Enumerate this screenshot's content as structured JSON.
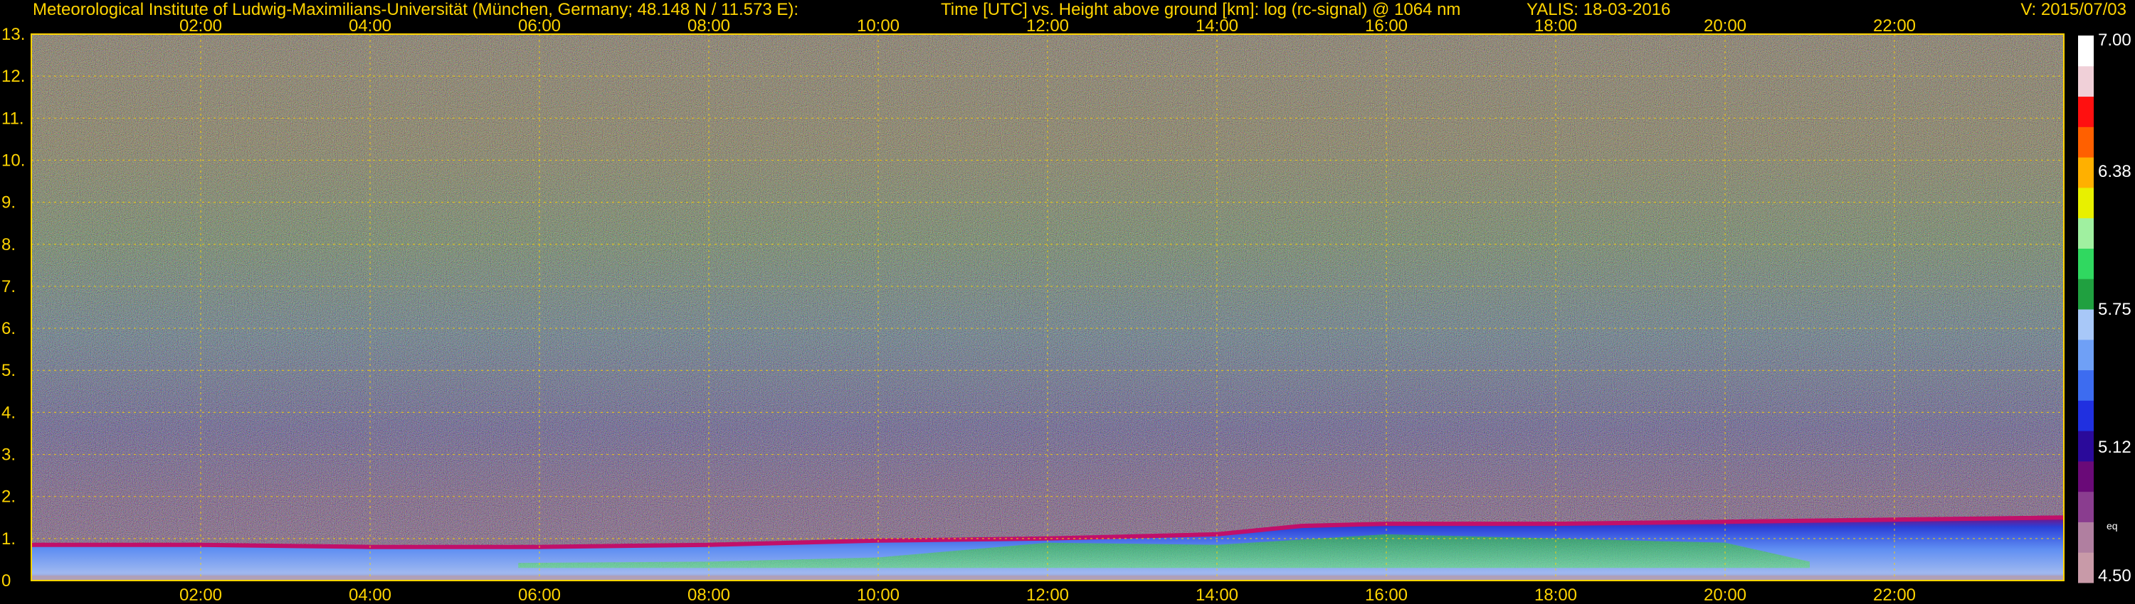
{
  "header": {
    "institute": "Meteorological Institute of Ludwig-Maximilians-Universität (München, Germany; 48.148 N / 11.573 E):",
    "title": "Time [UTC] vs. Height above ground [km]: log (rc-signal) @ 1064 nm",
    "instrument": "YALIS: 18-03-2016",
    "version": "V: 2015/07/03"
  },
  "colors": {
    "background": "#000000",
    "text": "#ffd400",
    "grid": "#ffd400",
    "colorbar_labels": "#ffffff"
  },
  "chart_data": {
    "type": "heatmap",
    "title": "Time [UTC] vs. Height above ground [km]: log (rc-signal) @ 1064 nm",
    "xlabel": "Time [UTC]",
    "ylabel": "Height above ground [km]",
    "x_range": [
      "00:00",
      "24:00"
    ],
    "x_ticks": [
      "02:00",
      "04:00",
      "06:00",
      "08:00",
      "10:00",
      "12:00",
      "14:00",
      "16:00",
      "18:00",
      "20:00",
      "22:00"
    ],
    "y_range": [
      0,
      13
    ],
    "y_ticks": [
      "0",
      "1.",
      "2.",
      "3.",
      "4.",
      "5.",
      "6.",
      "7.",
      "8.",
      "9.",
      "10.",
      "11.",
      "12.",
      "13."
    ],
    "grid": true,
    "colorbar": {
      "range": [
        4.5,
        7.0
      ],
      "tick_labels": [
        "7.00",
        "6.38",
        "5.75",
        "5.12",
        "4.50"
      ],
      "tick_values": [
        7.0,
        6.38,
        5.75,
        5.12,
        4.5
      ],
      "note": "eq",
      "colors": [
        "#c89aa8",
        "#b07fa0",
        "#8a3d8f",
        "#6a0a78",
        "#2a0a9a",
        "#2030e0",
        "#3d6cf0",
        "#6fa0f6",
        "#a8c8f8",
        "#20a040",
        "#30d860",
        "#a0f0a0",
        "#e8f000",
        "#ffb000",
        "#ff6000",
        "#ff1010",
        "#f0d0d8",
        "#ffffff"
      ]
    },
    "boundary_layer_top_km": [
      {
        "time": "00:00",
        "height": 0.85
      },
      {
        "time": "02:00",
        "height": 0.85
      },
      {
        "time": "04:00",
        "height": 0.8
      },
      {
        "time": "06:00",
        "height": 0.8
      },
      {
        "time": "08:00",
        "height": 0.85
      },
      {
        "time": "10:00",
        "height": 0.95
      },
      {
        "time": "12:00",
        "height": 1.0
      },
      {
        "time": "14:00",
        "height": 1.1
      },
      {
        "time": "15:00",
        "height": 1.3
      },
      {
        "time": "16:00",
        "height": 1.35
      },
      {
        "time": "18:00",
        "height": 1.35
      },
      {
        "time": "20:00",
        "height": 1.4
      },
      {
        "time": "22:00",
        "height": 1.45
      },
      {
        "time": "24:00",
        "height": 1.5
      }
    ]
  }
}
